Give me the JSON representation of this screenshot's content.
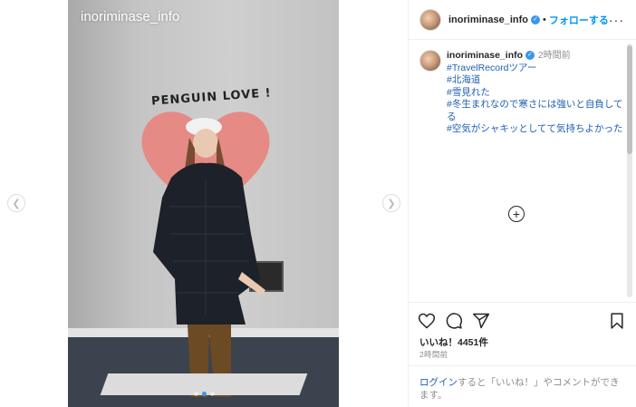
{
  "media": {
    "overlay_username": "inoriminase_info",
    "sign_text": "PENGUIN LOVE !",
    "dots": [
      false,
      true,
      false
    ],
    "prev_icon": "chevron-left-icon",
    "next_icon": "chevron-right-icon"
  },
  "header": {
    "username": "inoriminase_info",
    "separator": "•",
    "follow_label": "フォローする",
    "more_label": "···"
  },
  "comment": {
    "username": "inoriminase_info",
    "time": "2時間前",
    "hashtags": [
      "#TravelRecordツアー",
      "#北海道",
      "#雪見れた",
      "#冬生まれなので寒さには強いと自負してる",
      "#空気がシャキッとしてて気持ちよかった"
    ]
  },
  "load_more_label": "+",
  "actions": {
    "likes": "いいね！4451件",
    "time": "2時間前",
    "login_link": "ログイン",
    "login_text": "すると「いいね！」やコメントができます。"
  },
  "colors": {
    "accent": "#0095f6",
    "hashtag": "#1f5fb4",
    "muted": "#8e8e8e",
    "text": "#262626"
  }
}
